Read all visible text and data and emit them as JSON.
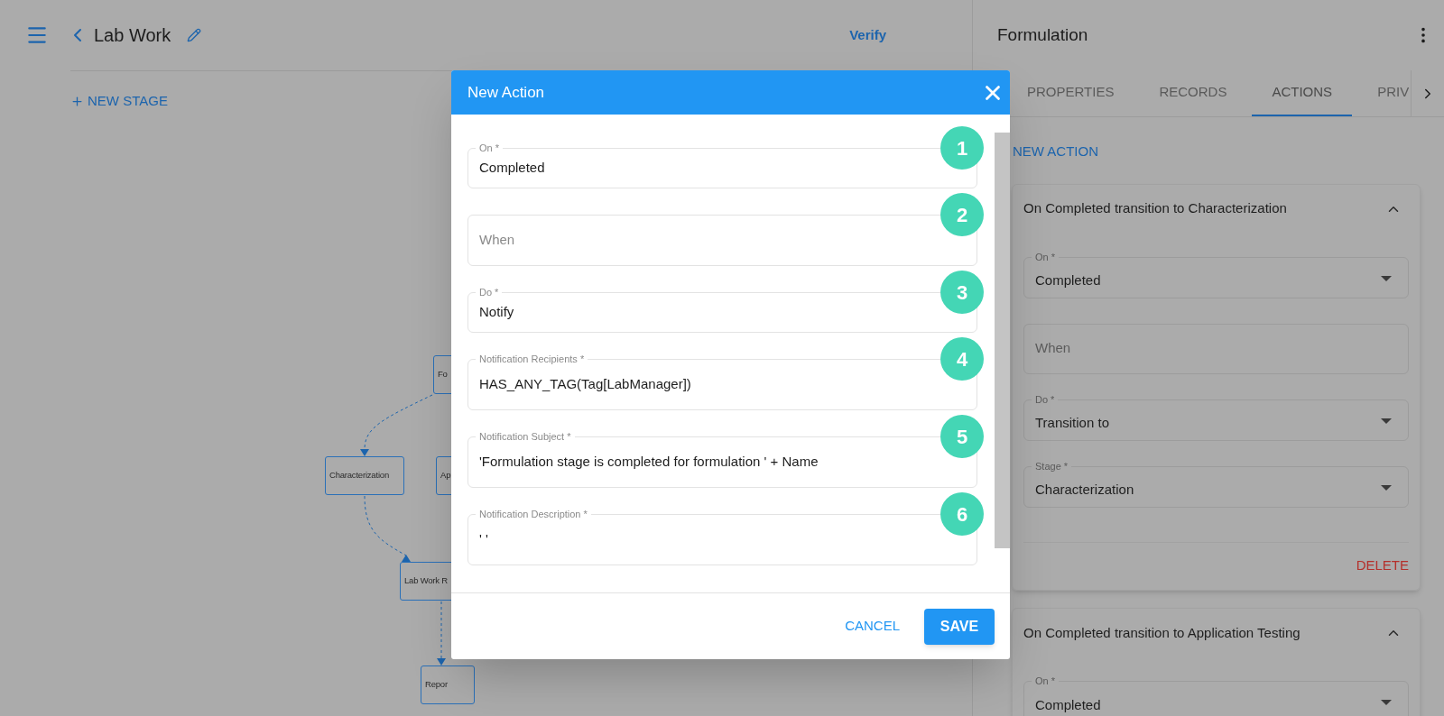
{
  "header": {
    "title": "Lab Work",
    "verify": "Verify"
  },
  "new_stage": "NEW STAGE",
  "diagram": {
    "nodes": [
      {
        "label": "Fo"
      },
      {
        "label": "Characterization"
      },
      {
        "label": "Ap"
      },
      {
        "label": "Lab Work R"
      },
      {
        "label": "Repor"
      }
    ]
  },
  "panel": {
    "title": "Formulation",
    "tabs": [
      {
        "label": "PROPERTIES",
        "selected": false
      },
      {
        "label": "RECORDS",
        "selected": false
      },
      {
        "label": "ACTIONS",
        "selected": true
      },
      {
        "label": "PRIV",
        "selected": false
      }
    ],
    "new_action": "NEW ACTION",
    "actions": [
      {
        "title": "On Completed transition to Characterization",
        "expanded": true,
        "fields": [
          {
            "kind": "select",
            "label": "On *",
            "value": "Completed"
          },
          {
            "kind": "text",
            "placeholder": "When"
          },
          {
            "kind": "select",
            "label": "Do *",
            "value": "Transition to"
          },
          {
            "kind": "select",
            "label": "Stage *",
            "value": "Characterization"
          }
        ],
        "delete": "DELETE"
      },
      {
        "title": "On Completed transition to Application Testing",
        "expanded": true,
        "fields": [
          {
            "kind": "select",
            "label": "On *",
            "value": "Completed"
          }
        ]
      }
    ]
  },
  "modal": {
    "title": "New Action",
    "fields": [
      {
        "kind": "select",
        "label": "On *",
        "value": "Completed",
        "step": "1"
      },
      {
        "kind": "text",
        "placeholder": "When",
        "step": "2"
      },
      {
        "kind": "select",
        "label": "Do *",
        "value": "Notify",
        "step": "3"
      },
      {
        "kind": "text",
        "label": "Notification Recipients *",
        "value": "HAS_ANY_TAG(Tag[LabManager])",
        "step": "4"
      },
      {
        "kind": "text",
        "label": "Notification Subject *",
        "value": "'Formulation stage is completed for formulation ' + Name",
        "step": "5"
      },
      {
        "kind": "text",
        "label": "Notification Description *",
        "value": "' '",
        "step": "6"
      }
    ],
    "cancel": "CANCEL",
    "save": "SAVE"
  }
}
